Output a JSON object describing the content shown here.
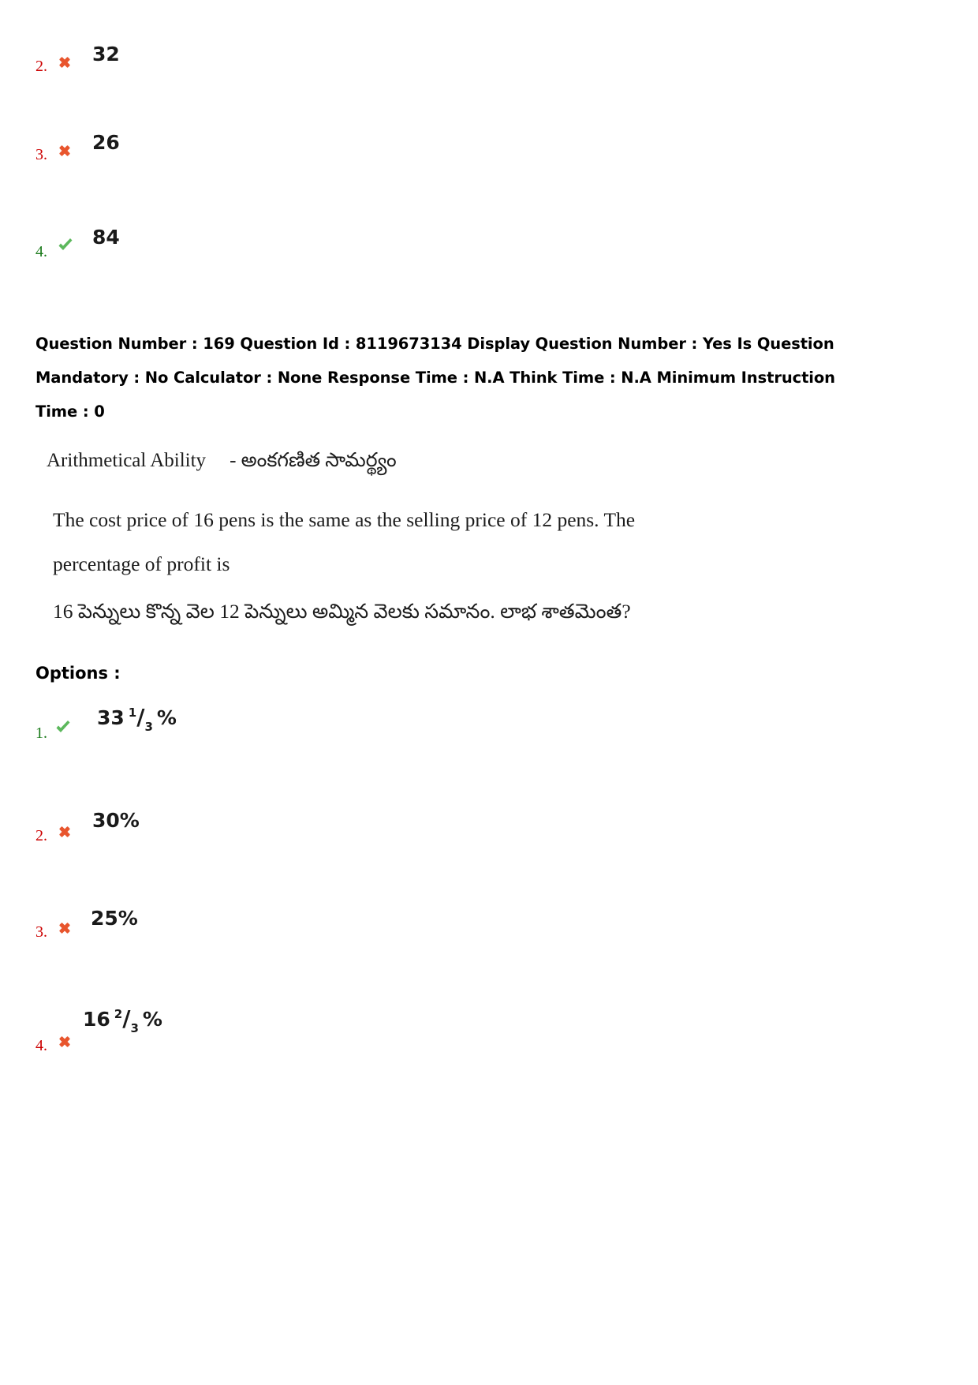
{
  "previous_question_options": [
    {
      "number": "2.",
      "mark": "cross-icon",
      "status": "wrong",
      "text": "32"
    },
    {
      "number": "3.",
      "mark": "cross-icon",
      "status": "wrong",
      "text": "26"
    },
    {
      "number": "4.",
      "mark": "check-icon",
      "status": "correct",
      "text": "84"
    }
  ],
  "question_meta": {
    "text": "Question Number : 169 Question Id : 8119673134 Display Question Number : Yes Is Question Mandatory : No Calculator : None Response Time : N.A Think Time : N.A Minimum Instruction Time : 0",
    "question_number": "169",
    "question_id": "8119673134",
    "display_question_number": "Yes",
    "is_question_mandatory": "No",
    "calculator": "None",
    "response_time": "N.A",
    "think_time": "N.A",
    "minimum_instruction_time": "0"
  },
  "question": {
    "subject_en": "Arithmetical Ability",
    "subject_separator": "-",
    "subject_te": "అంకగణిత సామర్థ్యం",
    "body_en": "The cost price of 16 pens is the same as the selling price of 12 pens. The percentage of profit is",
    "body_te": "16 పెన్నులు కొన్న వెల 12 పెన్నులు అమ్మిన వెలకు సమానం. లాభ శాతమెంత?"
  },
  "options_label": "Options :",
  "options": [
    {
      "number": "1.",
      "mark": "check-icon",
      "status": "correct",
      "whole": "33",
      "numerator": "1",
      "slash": "/",
      "denominator": "3",
      "percent": "%",
      "text": "33 1/3 %"
    },
    {
      "number": "2.",
      "mark": "cross-icon",
      "status": "wrong",
      "text": "30%"
    },
    {
      "number": "3.",
      "mark": "cross-icon",
      "status": "wrong",
      "text": "25%"
    },
    {
      "number": "4.",
      "mark": "cross-icon",
      "status": "wrong",
      "whole": "16",
      "numerator": "2",
      "slash": "/",
      "denominator": "3",
      "percent": "%",
      "text": "16 2/3 %"
    }
  ],
  "colors": {
    "wrong": "#cc0000",
    "correct": "#1a7a1a",
    "cross_mark": "#e8552d",
    "check_mark": "#5cb85c",
    "text": "#000000"
  }
}
